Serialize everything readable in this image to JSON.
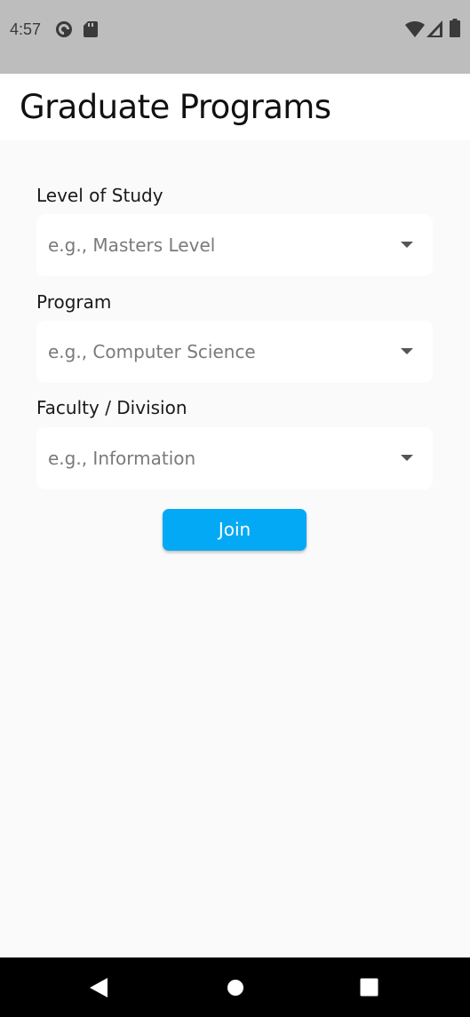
{
  "status_bar": {
    "time": "4:57",
    "left_icons": [
      "pocket-casts-icon",
      "sd-card-icon"
    ],
    "right_icons": [
      "wifi-icon",
      "cell-signal-icon",
      "battery-icon"
    ]
  },
  "header": {
    "title": "Graduate Programs"
  },
  "form": {
    "fields": [
      {
        "label": "Level of Study",
        "placeholder": "e.g., Masters Level"
      },
      {
        "label": "Program",
        "placeholder": "e.g., Computer Science"
      },
      {
        "label": "Faculty / Division",
        "placeholder": "e.g., Information"
      }
    ],
    "join_label": "Join"
  },
  "colors": {
    "status_bar": "#bdbdbd",
    "header_bg": "#ffffff",
    "page_bg": "#fafafa",
    "accent": "#03a9f4",
    "nav_bar": "#000000"
  },
  "nav_bar": {
    "buttons": [
      "back-icon",
      "home-icon",
      "recents-icon"
    ]
  }
}
